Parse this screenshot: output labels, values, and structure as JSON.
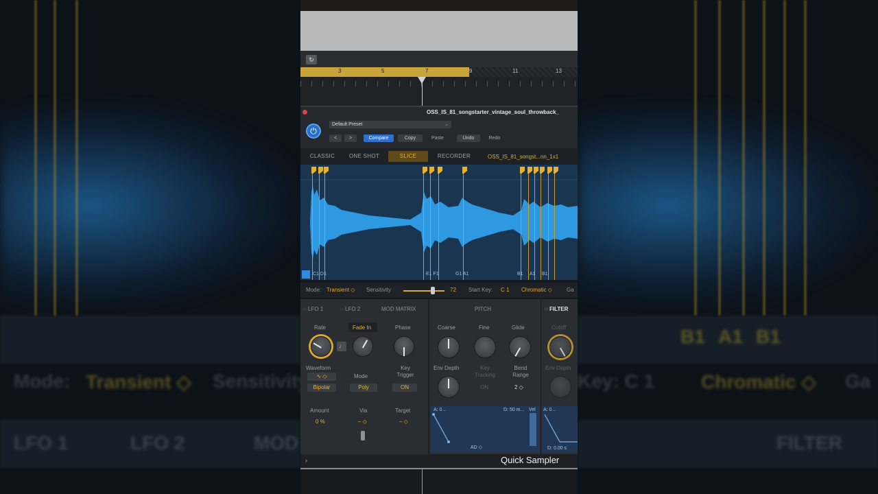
{
  "background": {
    "left_blur_text": [
      "Mode:",
      "Transient ◇",
      "Sensitivity",
      "LFO 1",
      "LFO 2",
      "MOD"
    ],
    "right_blur_text": [
      "Key: C 1",
      "Chromatic ◇",
      "Ga",
      "FILTER",
      "B1",
      "A1",
      "B1"
    ]
  },
  "ruler": {
    "numbers": [
      "3",
      "5",
      "7",
      "9",
      "11",
      "13"
    ]
  },
  "plugin": {
    "title": "OSS_IS_81_songstarter_vintage_soul_throwback_",
    "preset": "Default Preset",
    "buttons": {
      "back": "<",
      "forward": ">",
      "compare": "Compare",
      "copy": "Copy",
      "paste": "Paste",
      "undo": "Undo",
      "redo": "Redo"
    },
    "power_symbol": "⏻"
  },
  "mode_tabs": {
    "classic": "CLASSIC",
    "one_shot": "ONE SHOT",
    "slice": "SLICE",
    "recorder": "RECORDER",
    "filename": "OSS_IS_81_songst...nn_1x1"
  },
  "slice_labels": [
    "C1 D1",
    "E1 F1",
    "G1 A1",
    "B1",
    "A1",
    "B1"
  ],
  "mode_bar": {
    "mode_label": "Mode:",
    "mode_value": "Transient ◇",
    "sensitivity_label": "Sensitivity",
    "sensitivity_value": "72",
    "sensitivity_level": 0.72,
    "start_key_label": "Start Key:",
    "start_key_value": "C 1",
    "chromatic": "Chromatic ◇",
    "gate": "Ga"
  },
  "lfo": {
    "tab_lfo1": "LFO 1",
    "tab_lfo2": "LFO 2",
    "tab_mod_matrix": "MOD MATRIX",
    "rate_label": "Rate",
    "fade_in_label": "Fade In",
    "phase_label": "Phase",
    "waveform_label": "Waveform",
    "waveform_value": "∿ ◇",
    "bipolar": "Bipolar",
    "mode_label": "Mode",
    "mode_value": "Poly",
    "key_trigger_label": "Key Trigger",
    "key_trigger_value": "ON",
    "amount_label": "Amount",
    "amount_value": "0 %",
    "via_label": "Via",
    "via_value": "– ◇",
    "target_label": "Target",
    "target_value": "– ◇"
  },
  "pitch": {
    "title": "PITCH",
    "coarse_label": "Coarse",
    "fine_label": "Fine",
    "glide_label": "Glide",
    "env_depth_label": "Env Depth",
    "key_tracking_label": "Key Tracking",
    "key_tracking_value": "ON",
    "bend_range_label": "Bend Range",
    "bend_range_value": "2 ◇",
    "env_a_label": "A: 0...",
    "env_d_label": "D: 50 m...",
    "env_ad_label": "AD ◇",
    "env_vel": "Vel"
  },
  "filter": {
    "title": "FILTER",
    "cutoff_label": "Cutoff",
    "env_depth_label": "Env Depth",
    "env_a_label": "A: 0...",
    "env_d_label": "D: 0.00 s"
  },
  "bottom": {
    "title": "Quick Sampler",
    "chevron": "›"
  },
  "colors": {
    "accent_yellow": "#e4b536",
    "waveform_blue": "#2f9ee8",
    "power_blue": "#2a6fc4",
    "slice_line": "#c99e2a"
  }
}
